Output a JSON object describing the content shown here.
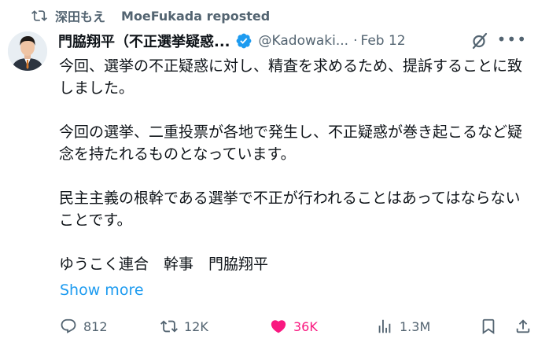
{
  "repost": {
    "reposter_name": "深田もえ",
    "label": "MoeFukada reposted"
  },
  "tweet": {
    "author_name": "門脇翔平（不正選挙疑惑...",
    "handle": "@Kadowaki...",
    "separator": "·",
    "date": "Feb 12",
    "paragraphs": [
      "今回、選挙の不正疑惑に対し、精査を求めるため、提訴することに致しました。",
      "今回の選挙、二重投票が各地で発生し、不正疑惑が巻き起こるなど疑念を持たれるものとなっています。",
      "民主主義の根幹である選挙で不正が行われることはあってはならないことです。",
      "ゆうこく連合　幹事　門脇翔平"
    ],
    "show_more": "Show more"
  },
  "actions": {
    "replies": "812",
    "reposts": "12K",
    "likes": "36K",
    "views": "1.3M"
  },
  "colors": {
    "text": "#0f1419",
    "secondary": "#536471",
    "link": "#1d9bf0",
    "like": "#f91880",
    "verified": "#1d9bf0"
  }
}
